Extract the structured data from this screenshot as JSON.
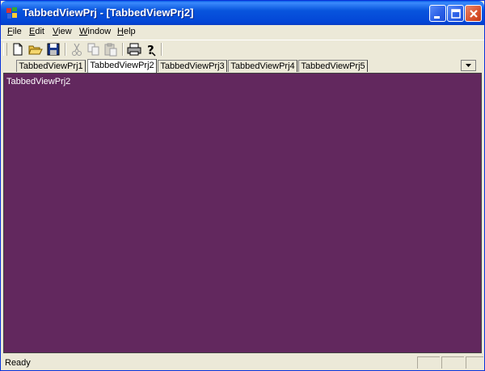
{
  "window": {
    "title": "TabbedViewPrj - [TabbedViewPrj2]",
    "titlebar_color": "#0a5fe8"
  },
  "title_buttons": {
    "minimize": "minimize",
    "maximize": "maximize",
    "close": "close"
  },
  "menu": [
    {
      "label": "File",
      "underline": "F",
      "rest": "ile"
    },
    {
      "label": "Edit",
      "underline": "E",
      "rest": "dit"
    },
    {
      "label": "View",
      "underline": "V",
      "rest": "iew"
    },
    {
      "label": "Window",
      "underline": "W",
      "rest": "indow"
    },
    {
      "label": "Help",
      "underline": "H",
      "rest": "elp"
    }
  ],
  "toolbar": {
    "icons": [
      "new-file-icon",
      "open-folder-icon",
      "save-icon",
      "cut-icon",
      "copy-icon",
      "paste-icon",
      "print-icon",
      "help-icon"
    ]
  },
  "tabs": [
    {
      "label": "TabbedViewPrj1",
      "active": false
    },
    {
      "label": "TabbedViewPrj2",
      "active": true
    },
    {
      "label": "TabbedViewPrj3",
      "active": false
    },
    {
      "label": "TabbedViewPrj4",
      "active": false
    },
    {
      "label": "TabbedViewPrj5",
      "active": false
    }
  ],
  "content": {
    "text": "TabbedViewPrj2",
    "background": "#62285e"
  },
  "status": {
    "text": "Ready"
  }
}
